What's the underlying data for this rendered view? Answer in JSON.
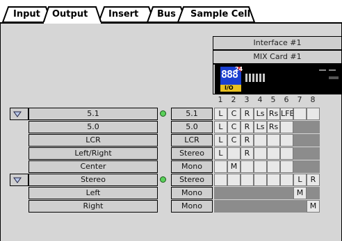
{
  "tabs": [
    {
      "label": "Input"
    },
    {
      "label": "Output"
    },
    {
      "label": "Insert"
    },
    {
      "label": "Bus"
    },
    {
      "label": "Sample Cell"
    }
  ],
  "interface_header": "Interface #1",
  "card_header": "MIX Card #1",
  "card_badge_top": "888",
  "card_badge_num": "24",
  "card_badge_io": "I/O",
  "channel_numbers": [
    "1",
    "2",
    "3",
    "4",
    "5",
    "6",
    "7",
    "8"
  ],
  "rows": [
    {
      "name": "5.1",
      "format": "5.1",
      "expand": true,
      "led": true,
      "grid": [
        "L",
        "C",
        "R",
        "Ls",
        "Rs",
        "LFE",
        "",
        ""
      ]
    },
    {
      "name": "5.0",
      "format": "5.0",
      "expand": false,
      "led": false,
      "grid": [
        "L",
        "C",
        "R",
        "Ls",
        "Rs",
        "",
        "",
        ""
      ]
    },
    {
      "name": "LCR",
      "format": "LCR",
      "expand": false,
      "led": false,
      "grid": [
        "L",
        "C",
        "R",
        "",
        "",
        "",
        "",
        ""
      ]
    },
    {
      "name": "Left/Right",
      "format": "Stereo",
      "expand": false,
      "led": false,
      "grid": [
        "L",
        "",
        "R",
        "",
        "",
        "",
        "",
        ""
      ]
    },
    {
      "name": "Center",
      "format": "Mono",
      "expand": false,
      "led": false,
      "grid": [
        "",
        "M",
        "",
        "",
        "",
        "",
        "",
        ""
      ]
    },
    {
      "name": "Stereo",
      "format": "Stereo",
      "expand": true,
      "led": true,
      "grid": [
        "",
        "",
        "",
        "",
        "",
        "",
        "L",
        "R"
      ]
    },
    {
      "name": "Left",
      "format": "Mono",
      "expand": false,
      "led": false,
      "grid": [
        "",
        "",
        "",
        "",
        "",
        "",
        "M",
        ""
      ]
    },
    {
      "name": "Right",
      "format": "Mono",
      "expand": false,
      "led": false,
      "grid": [
        "",
        "",
        "",
        "",
        "",
        "",
        "",
        "M"
      ]
    }
  ]
}
